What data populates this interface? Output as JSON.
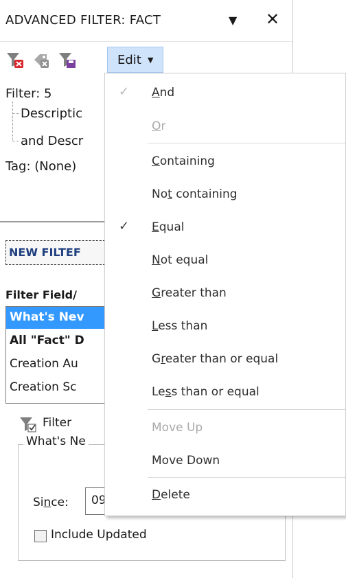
{
  "panel": {
    "title": "ADVANCED FILTER:  FACT",
    "title_dropdown_icon": "triangle-down",
    "title_close": "✕",
    "edit_button": "Edit"
  },
  "filter_tree": {
    "filter_count": "Filter: 5",
    "line1": "Descriptic",
    "line2": "and Descr",
    "tag": "Tag: (None)"
  },
  "new_filter": {
    "label": "NEW FILTEF",
    "field_label": "Filter Field/",
    "fields": [
      "What's Nev",
      "All \"Fact\" D",
      "Creation Au",
      "Creation Sc"
    ],
    "filter_button": "Filter",
    "group_legend": "What's Ne",
    "since_label": "Since:",
    "since_value": "09",
    "include_updated": "Include Updated"
  },
  "menu": {
    "items": [
      {
        "label": "And",
        "checked": true,
        "enabled": true,
        "accel": 0
      },
      {
        "label": "Or",
        "checked": false,
        "enabled": false,
        "accel": 0
      },
      {
        "label": "Containing",
        "checked": false,
        "enabled": true,
        "accel": 0
      },
      {
        "label": "Not containing",
        "checked": false,
        "enabled": true,
        "accel": 2
      },
      {
        "label": "Equal",
        "checked": true,
        "enabled": true,
        "accel": 0
      },
      {
        "label": "Not equal",
        "checked": false,
        "enabled": true,
        "accel": 0
      },
      {
        "label": "Greater than",
        "checked": false,
        "enabled": true,
        "accel": 0
      },
      {
        "label": "Less than",
        "checked": false,
        "enabled": true,
        "accel": 0
      },
      {
        "label": "Greater than or equal",
        "checked": false,
        "enabled": true,
        "accel": 1
      },
      {
        "label": "Less than or equal",
        "checked": false,
        "enabled": true,
        "accel": 2
      },
      {
        "label": "Move Up",
        "checked": false,
        "enabled": false,
        "accel": -1
      },
      {
        "label": "Move Down",
        "checked": false,
        "enabled": true,
        "accel": -1
      },
      {
        "label": "Delete",
        "checked": false,
        "enabled": true,
        "accel": 0
      }
    ],
    "check_glyph": "✓"
  },
  "colors": {
    "selection": "#3399ff",
    "edit_highlight": "#cfe3fa",
    "link_blue": "#1f3f7f"
  }
}
